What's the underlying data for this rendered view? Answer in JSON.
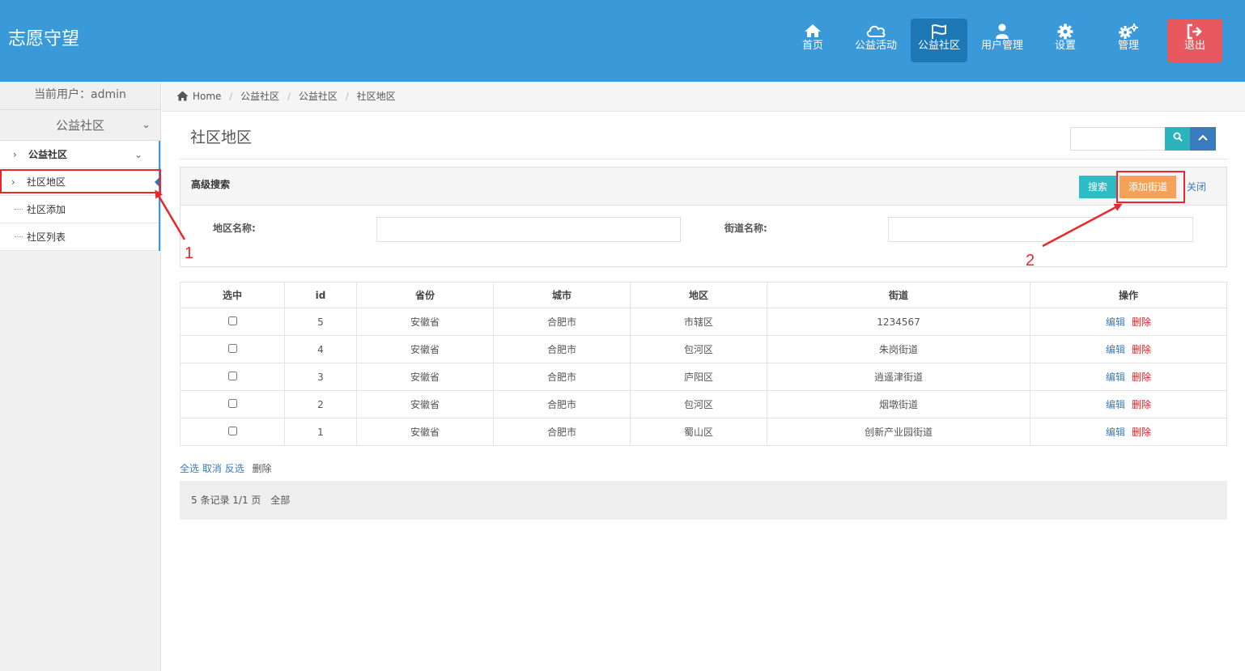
{
  "app": {
    "brand": "志愿守望"
  },
  "nav": {
    "items": [
      {
        "label": "首页",
        "icon": "home-icon"
      },
      {
        "label": "公益活动",
        "icon": "cloud-icon"
      },
      {
        "label": "公益社区",
        "icon": "flag-icon",
        "active": true
      },
      {
        "label": "用户管理",
        "icon": "user-icon"
      },
      {
        "label": "设置",
        "icon": "gear-icon"
      },
      {
        "label": "管理",
        "icon": "gears-icon"
      },
      {
        "label": "退出",
        "icon": "sign-out-icon"
      }
    ]
  },
  "sidebar": {
    "current_user": "当前用户：admin",
    "menu_title": "公益社区",
    "submenu_title": "公益社区",
    "items": [
      {
        "label": "社区地区",
        "active": true
      },
      {
        "label": "社区添加"
      },
      {
        "label": "社区列表"
      }
    ]
  },
  "breadcrumb": {
    "home": "Home",
    "items": [
      "公益社区",
      "公益社区",
      "社区地区"
    ]
  },
  "page": {
    "title": "社区地区"
  },
  "advanced_search": {
    "title": "高级搜索",
    "search_label": "搜索",
    "add_label": "添加街道",
    "close_label": "关闭",
    "region_label": "地区名称:",
    "region_value": "",
    "street_label": "街道名称:",
    "street_value": ""
  },
  "table": {
    "headers": [
      "选中",
      "id",
      "省份",
      "城市",
      "地区",
      "街道",
      "操作"
    ],
    "rows": [
      {
        "id": "5",
        "province": "安徽省",
        "city": "合肥市",
        "district": "市辖区",
        "street": "1234567"
      },
      {
        "id": "4",
        "province": "安徽省",
        "city": "合肥市",
        "district": "包河区",
        "street": "朱岗街道"
      },
      {
        "id": "3",
        "province": "安徽省",
        "city": "合肥市",
        "district": "庐阳区",
        "street": "逍遥津街道"
      },
      {
        "id": "2",
        "province": "安徽省",
        "city": "合肥市",
        "district": "包河区",
        "street": "烟墩街道"
      },
      {
        "id": "1",
        "province": "安徽省",
        "city": "合肥市",
        "district": "蜀山区",
        "street": "创新产业园街道"
      }
    ],
    "edit_label": "编辑",
    "delete_label": "删除"
  },
  "bulk": {
    "select_all": "全选",
    "cancel": "取消",
    "invert": "反选",
    "delete": "删除"
  },
  "pager": {
    "summary": "5 条记录 1/1 页",
    "all": "全部"
  },
  "annotations": {
    "marker_1": "1",
    "marker_2": "2"
  },
  "colors": {
    "header": "#3a99d9",
    "active_nav": "#1f78b6",
    "logout": "#e8585f",
    "add_button": "#f4a259",
    "search_button": "#2bbcc4",
    "annotation": "#e8282b"
  }
}
